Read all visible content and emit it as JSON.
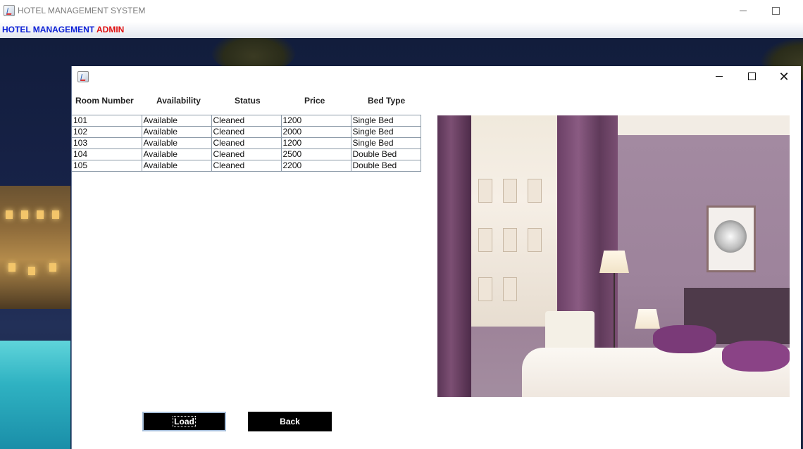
{
  "main_window": {
    "title": "HOTEL MANAGEMENT SYSTEM",
    "icon": "java-cup-icon",
    "controls": [
      "minimize-icon",
      "maximize-icon"
    ]
  },
  "menubar": {
    "items": [
      {
        "label": "HOTEL MANAGEMENT",
        "color": "#0a1ed6"
      },
      {
        "label": "ADMIN",
        "color": "#e01010"
      }
    ]
  },
  "dialog": {
    "icon": "java-cup-icon",
    "controls": [
      "minimize-icon",
      "maximize-icon",
      "close-icon"
    ],
    "columns": [
      "Room Number",
      "Availability",
      "Status",
      "Price",
      "Bed Type"
    ],
    "rows": [
      [
        "101",
        "Available",
        "Cleaned",
        "1200",
        "Single Bed"
      ],
      [
        "102",
        "Available",
        "Cleaned",
        "2000",
        "Single Bed"
      ],
      [
        "103",
        "Available",
        "Cleaned",
        "1200",
        "Single Bed"
      ],
      [
        "104",
        "Available",
        "Cleaned",
        "2500",
        "Double Bed"
      ],
      [
        "105",
        "Available",
        "Cleaned",
        "2200",
        "Double Bed"
      ]
    ],
    "load_label": "Load",
    "back_label": "Back"
  },
  "colors": {
    "button_bg": "#000000",
    "button_text": "#ffffff",
    "table_border": "#8c9aa8"
  }
}
